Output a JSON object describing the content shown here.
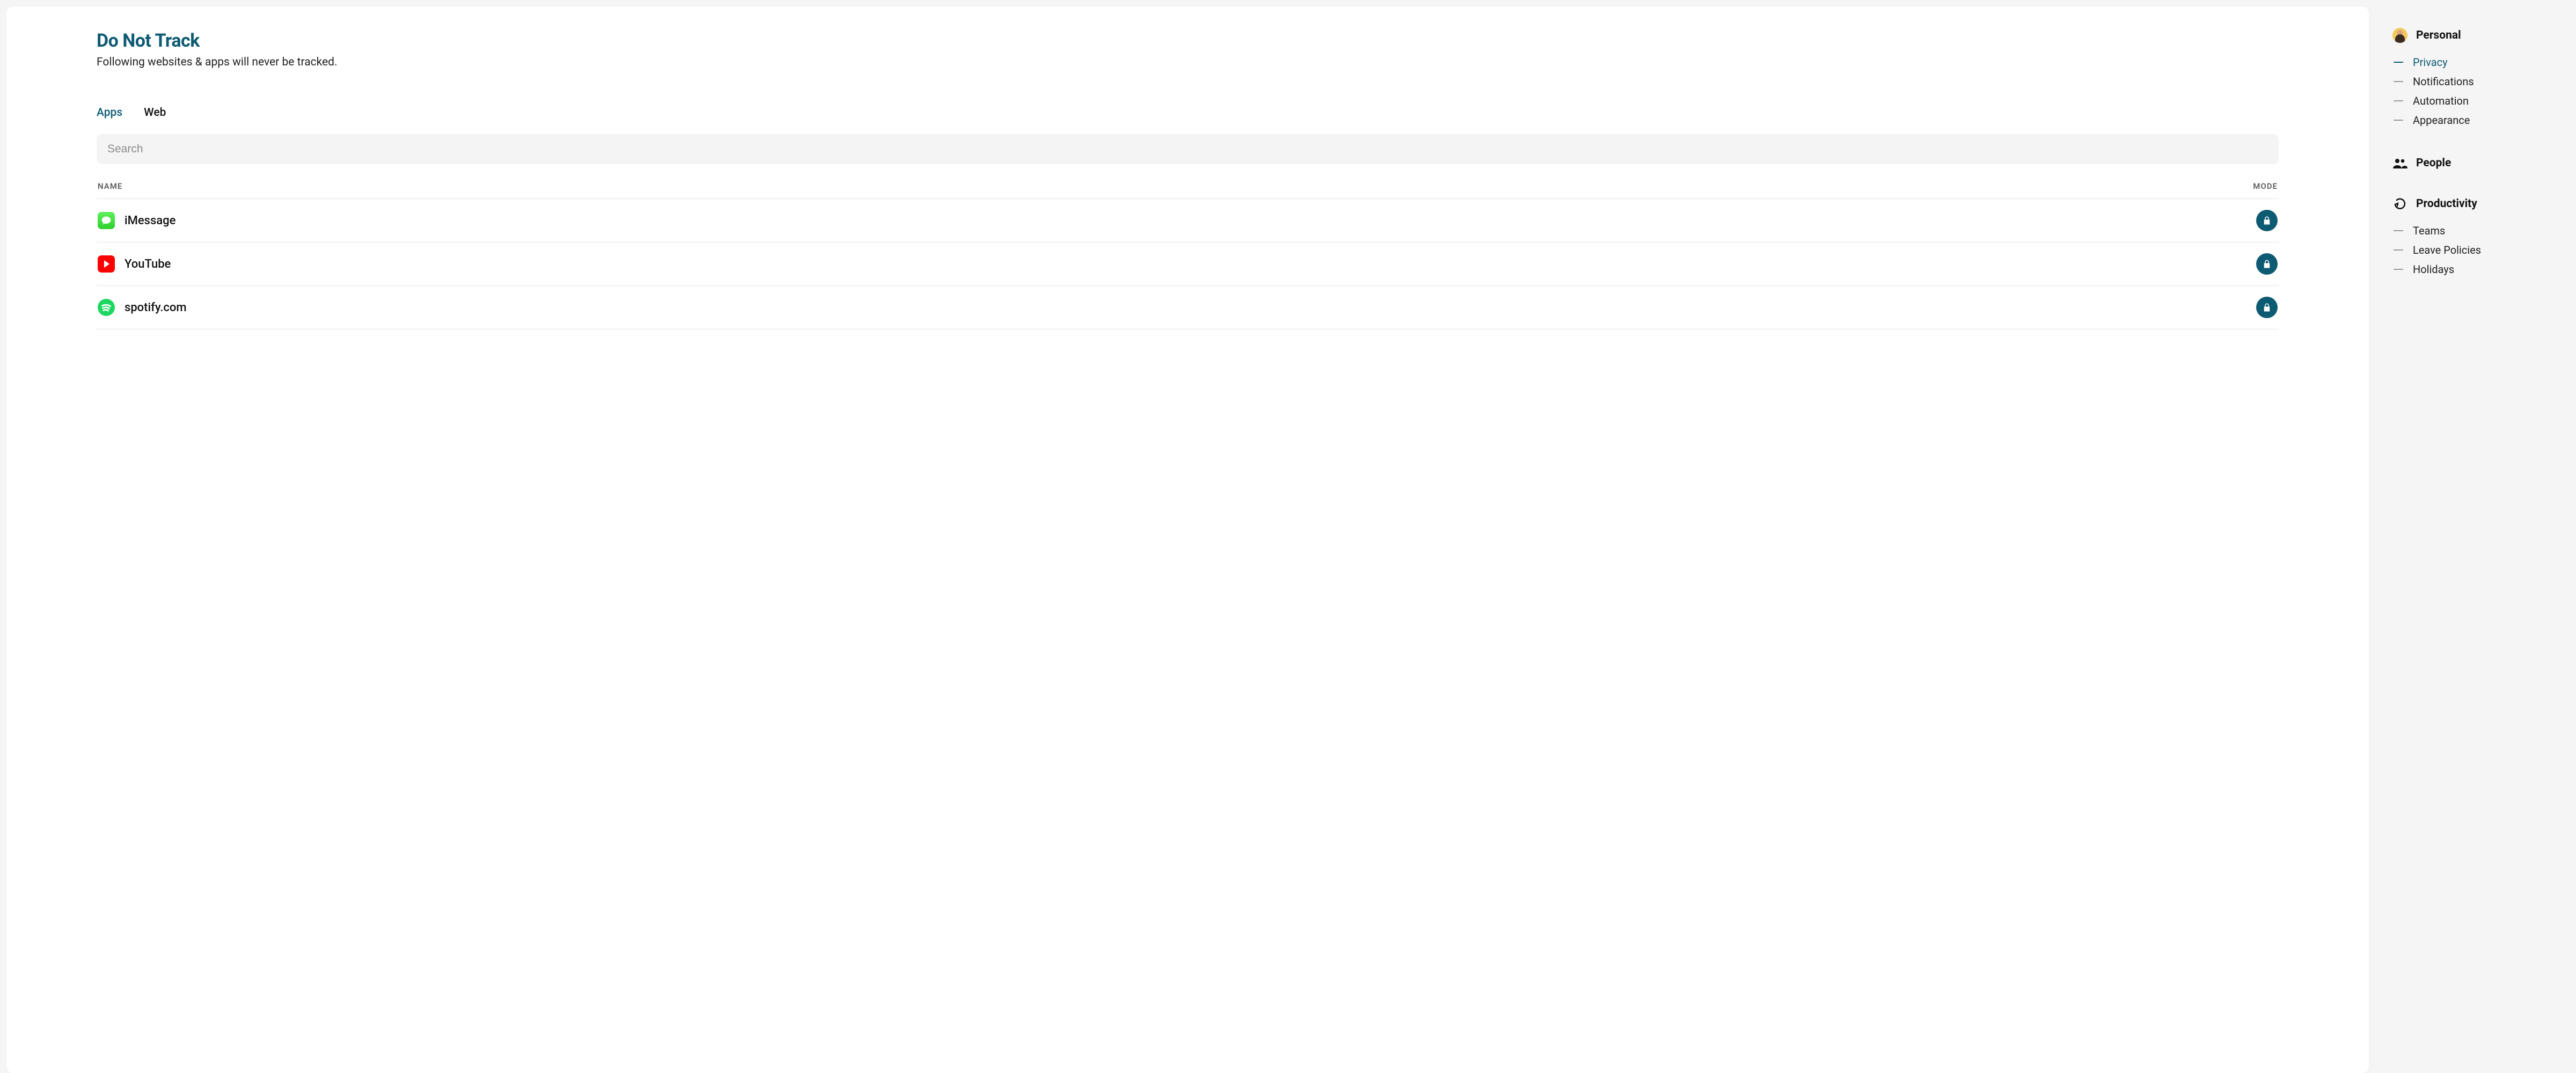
{
  "page": {
    "title": "Do Not Track",
    "subtitle": "Following websites & apps will never be tracked."
  },
  "tabs": [
    {
      "label": "Apps",
      "active": true
    },
    {
      "label": "Web",
      "active": false
    }
  ],
  "search": {
    "placeholder": "Search",
    "value": ""
  },
  "table": {
    "columns": {
      "name": "NAME",
      "mode": "MODE"
    },
    "rows": [
      {
        "icon": "imessage",
        "name": "iMessage",
        "mode": "locked"
      },
      {
        "icon": "youtube",
        "name": "YouTube",
        "mode": "locked"
      },
      {
        "icon": "spotify",
        "name": "spotify.com",
        "mode": "locked"
      }
    ]
  },
  "sidebar": {
    "groups": [
      {
        "icon": "avatar",
        "title": "Personal",
        "items": [
          {
            "label": "Privacy",
            "active": true
          },
          {
            "label": "Notifications",
            "active": false
          },
          {
            "label": "Automation",
            "active": false
          },
          {
            "label": "Appearance",
            "active": false
          }
        ]
      },
      {
        "icon": "people",
        "title": "People",
        "items": []
      },
      {
        "icon": "productivity",
        "title": "Productivity",
        "items": [
          {
            "label": "Teams",
            "active": false
          },
          {
            "label": "Leave Policies",
            "active": false
          },
          {
            "label": "Holidays",
            "active": false
          }
        ]
      }
    ]
  },
  "colors": {
    "accent": "#0d5a73"
  }
}
